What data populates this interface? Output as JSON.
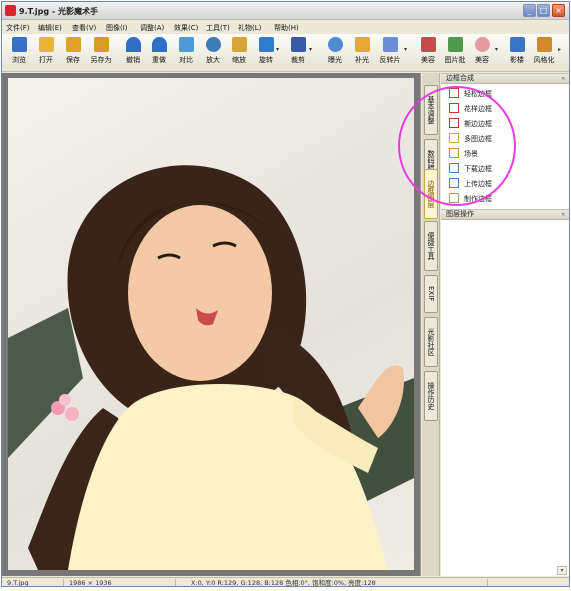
{
  "window": {
    "title": "9.T.jpg - 光影魔术手",
    "buttons": [
      "_",
      "□",
      "×"
    ]
  },
  "menu": [
    "文件(F)",
    "编辑(E)",
    "查看(V)",
    "图像(I)",
    "调整(A)",
    "效果(C)",
    "工具(T)",
    "礼物(L)",
    "帮助(H)"
  ],
  "toolbar": [
    {
      "label": "浏览",
      "icon": "browse-icon",
      "color": "#3b6fc2"
    },
    {
      "label": "打开",
      "icon": "open-folder-icon",
      "color": "#e8b53a"
    },
    {
      "label": "保存",
      "icon": "save-icon",
      "color": "#e2a127"
    },
    {
      "label": "另存为",
      "icon": "save-as-icon",
      "color": "#d99a28"
    },
    {
      "label": "撤销",
      "icon": "undo-icon",
      "color": "#2f6fc7"
    },
    {
      "label": "重做",
      "icon": "redo-icon",
      "color": "#2f6fc7"
    },
    {
      "label": "对比",
      "icon": "compare-icon",
      "color": "#4e9ad6"
    },
    {
      "label": "放大",
      "icon": "zoom-in-icon",
      "color": "#3d7bb8"
    },
    {
      "label": "缩放",
      "icon": "resize-icon",
      "color": "#d7a53a"
    },
    {
      "label": "旋转",
      "icon": "rotate-icon",
      "color": "#2f7ec9"
    },
    {
      "label": "裁剪",
      "icon": "crop-icon",
      "color": "#3a5aa8"
    },
    {
      "label": "曝光",
      "icon": "exposure-icon",
      "color": "#4c8bd1"
    },
    {
      "label": "补光",
      "icon": "fill-light-icon",
      "color": "#e5a830"
    },
    {
      "label": "反转片",
      "icon": "reversal-film-icon",
      "color": "#6b8fd6"
    },
    {
      "label": "美容",
      "icon": "beauty-icon",
      "color": "#c94a4a"
    },
    {
      "label": "图片批",
      "icon": "batch-icon",
      "color": "#4f9a4a"
    },
    {
      "label": "美容",
      "icon": "face-icon",
      "color": "#e59aa0"
    },
    {
      "label": "影楼",
      "icon": "studio-icon",
      "color": "#3a74c4"
    },
    {
      "label": "风格化",
      "icon": "stylize-icon",
      "color": "#d08a2c"
    }
  ],
  "side_tabs": [
    {
      "label": "基本调整",
      "active": false
    },
    {
      "label": "数码暗房",
      "active": false
    },
    {
      "label": "边框图层",
      "active": true
    },
    {
      "label": "便捷工具",
      "active": false
    },
    {
      "label": "EXIF",
      "active": false
    },
    {
      "label": "光影社区",
      "active": false
    },
    {
      "label": "操作历史",
      "active": false
    }
  ],
  "borders_panel": {
    "title": "边框合成",
    "items": [
      {
        "label": "轻松边框",
        "color": "#d0402a"
      },
      {
        "label": "花样边框",
        "color": "#c8342c"
      },
      {
        "label": "撕边边框",
        "color": "#b03528"
      },
      {
        "label": "多图边框",
        "color": "#d6a23a"
      },
      {
        "label": "场景",
        "color": "#d78a2e"
      },
      {
        "label": "下载边框",
        "color": "#3f7fd0"
      },
      {
        "label": "上传边框",
        "color": "#3f7fd0"
      },
      {
        "label": "制作边框",
        "color": "#b59a63"
      }
    ]
  },
  "layers_panel": {
    "title": "图层操作"
  },
  "status": {
    "filename": "9.T.jpg",
    "dimensions": "1986 × 1936",
    "info": "X:0, Y:0  R:129, G:128, B:128  色相:0°, 饱和度:0%, 亮度:128"
  },
  "colors": {
    "annotation": "#e83be0",
    "photo_bg": "#efece7"
  }
}
